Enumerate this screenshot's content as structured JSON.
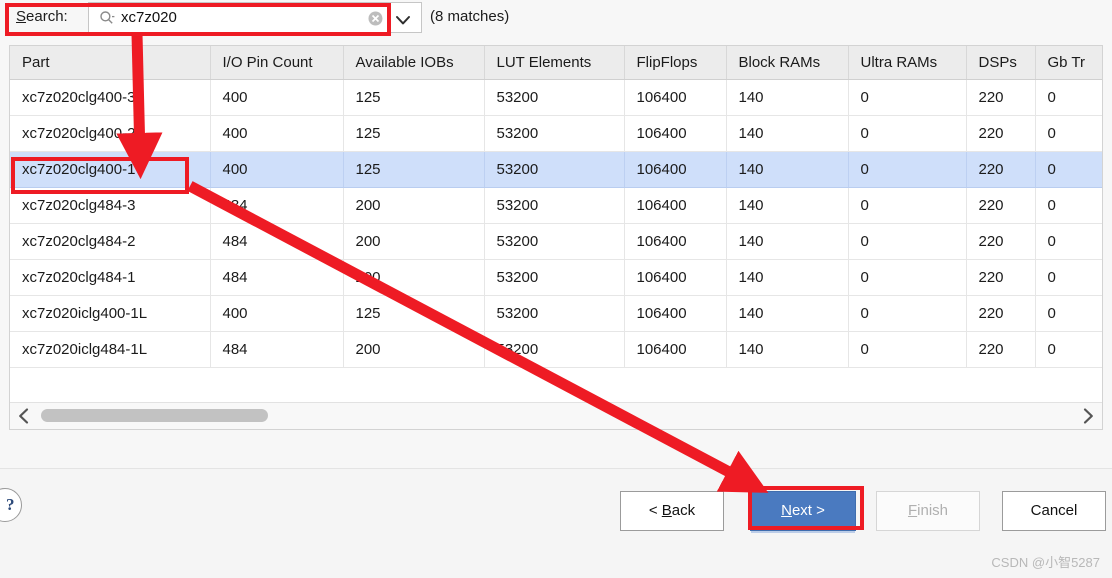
{
  "search": {
    "label_prefix": "S",
    "label_rest": "earch:",
    "value": "xc7z020",
    "placeholder": "",
    "search_icon": "search-icon",
    "clear_icon": "clear-circle-icon",
    "dropdown_icon": "chevron-down-icon",
    "match_count": "(8 matches)"
  },
  "table": {
    "columns": [
      "Part",
      "I/O Pin Count",
      "Available IOBs",
      "LUT Elements",
      "FlipFlops",
      "Block RAMs",
      "Ultra RAMs",
      "DSPs",
      "Gb Tr"
    ],
    "rows": [
      {
        "selected": false,
        "cells": [
          "xc7z020clg400-3",
          "400",
          "125",
          "53200",
          "106400",
          "140",
          "0",
          "220",
          "0"
        ]
      },
      {
        "selected": false,
        "cells": [
          "xc7z020clg400-2",
          "400",
          "125",
          "53200",
          "106400",
          "140",
          "0",
          "220",
          "0"
        ]
      },
      {
        "selected": true,
        "cells": [
          "xc7z020clg400-1",
          "400",
          "125",
          "53200",
          "106400",
          "140",
          "0",
          "220",
          "0"
        ]
      },
      {
        "selected": false,
        "cells": [
          "xc7z020clg484-3",
          "484",
          "200",
          "53200",
          "106400",
          "140",
          "0",
          "220",
          "0"
        ]
      },
      {
        "selected": false,
        "cells": [
          "xc7z020clg484-2",
          "484",
          "200",
          "53200",
          "106400",
          "140",
          "0",
          "220",
          "0"
        ]
      },
      {
        "selected": false,
        "cells": [
          "xc7z020clg484-1",
          "484",
          "200",
          "53200",
          "106400",
          "140",
          "0",
          "220",
          "0"
        ]
      },
      {
        "selected": false,
        "cells": [
          "xc7z020iclg400-1L",
          "400",
          "125",
          "53200",
          "106400",
          "140",
          "0",
          "220",
          "0"
        ]
      },
      {
        "selected": false,
        "cells": [
          "xc7z020iclg484-1L",
          "484",
          "200",
          "53200",
          "106400",
          "140",
          "0",
          "220",
          "0"
        ]
      }
    ]
  },
  "scrollbar": {
    "left_icon": "chevron-left-icon",
    "right_icon": "chevron-right-icon"
  },
  "buttons": {
    "help": "?",
    "back": {
      "pre": "< ",
      "mnemonic": "B",
      "post": "ack"
    },
    "next": {
      "pre": "",
      "mnemonic": "N",
      "post": "ext >"
    },
    "finish": {
      "pre": "",
      "mnemonic": "F",
      "post": "inish"
    },
    "cancel": {
      "pre": "",
      "mnemonic": "",
      "post": "Cancel"
    }
  },
  "watermark": "CSDN @小智5287",
  "colors": {
    "accent_blue": "#4a7ac0",
    "selection_blue": "#cfdffa",
    "annotation_red": "#ee1b24",
    "header_grey": "#ececec",
    "disabled_grey": "#b0b0b0"
  }
}
